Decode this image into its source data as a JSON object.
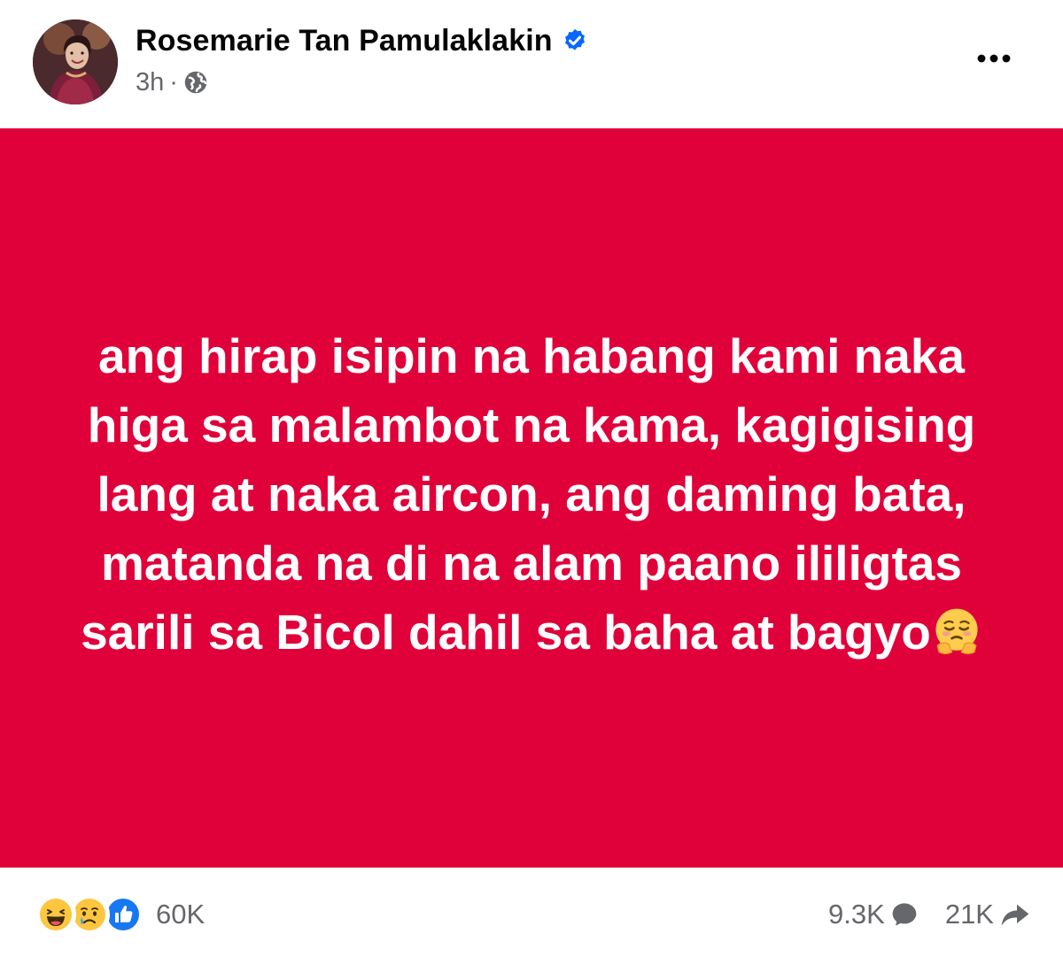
{
  "post": {
    "author_name": "Rosemarie Tan Pamulaklakin",
    "verified": true,
    "timestamp": "3h",
    "separator": "·",
    "audience_icon": "globe-icon",
    "more_icon": "more-options-icon",
    "text_lines": [
      "ang hirap isipin na habang kami naka",
      "higa sa malambot na kama, kagigising",
      "lang at naka aircon, ang daming bata,",
      "matanda na di na alam paano ililigtas",
      "sarili sa Bicol dahil sa baha at bagyo"
    ],
    "text_emoji": "face-holding-back-tears",
    "background_color": "#e0003a",
    "text_color": "#ffffff"
  },
  "footer": {
    "reactions": [
      "haha",
      "sad",
      "like"
    ],
    "reaction_count": "60K",
    "comment_count": "9.3K",
    "share_count": "21K",
    "comment_icon": "comment-bubble-icon",
    "share_icon": "share-arrow-icon"
  },
  "colors": {
    "secondary_text": "#65676b",
    "primary_text": "#050505",
    "verified_blue": "#0866ff",
    "like_blue": "#1877f2"
  }
}
